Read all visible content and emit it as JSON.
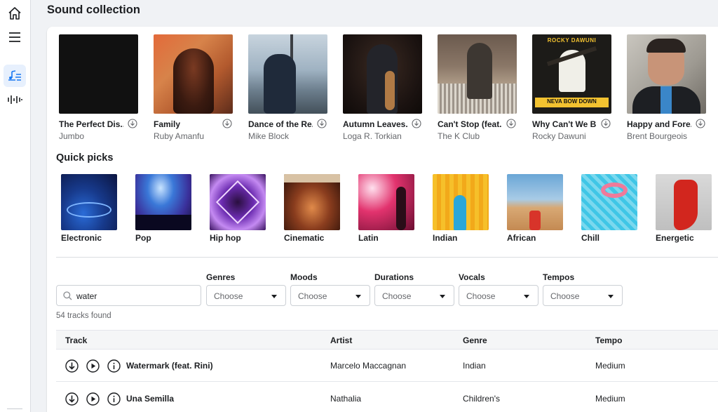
{
  "page_title": "Sound collection",
  "albums": [
    {
      "title": "The Perfect Dis...",
      "artist": "Jumbo"
    },
    {
      "title": "Family",
      "artist": "Ruby Amanfu"
    },
    {
      "title": "Dance of the Re...",
      "artist": "Mike Block"
    },
    {
      "title": "Autumn Leaves...",
      "artist": "Loga R. Torkian"
    },
    {
      "title": "Can't Stop (feat...",
      "artist": "The K Club"
    },
    {
      "title": "Why Can't We B...",
      "artist": "Rocky Dawuni"
    },
    {
      "title": "Happy and Fore...",
      "artist": "Brent Bourgeois"
    }
  ],
  "cover_art": {
    "rocky_top": "ROCKY DAWUNI",
    "rocky_bottom": "NEVA BOW DOWN"
  },
  "quick_picks": {
    "title": "Quick picks",
    "items": [
      "Electronic",
      "Pop",
      "Hip hop",
      "Cinematic",
      "Latin",
      "Indian",
      "African",
      "Chill",
      "Energetic"
    ]
  },
  "search": {
    "value": "water"
  },
  "filters": [
    {
      "label": "Genres",
      "value": "Choose"
    },
    {
      "label": "Moods",
      "value": "Choose"
    },
    {
      "label": "Durations",
      "value": "Choose"
    },
    {
      "label": "Vocals",
      "value": "Choose"
    },
    {
      "label": "Tempos",
      "value": "Choose"
    }
  ],
  "tracks_found": "54 tracks found",
  "table": {
    "headers": {
      "track": "Track",
      "artist": "Artist",
      "genre": "Genre",
      "tempo": "Tempo"
    },
    "rows": [
      {
        "track": "Watermark (feat. Rini)",
        "artist": "Marcelo Maccagnan",
        "genre": "Indian",
        "tempo": "Medium"
      },
      {
        "track": "Una Semilla",
        "artist": "Nathalia",
        "genre": "Children's",
        "tempo": "Medium"
      }
    ]
  },
  "colors": {
    "accent": "#1877f2",
    "background": "#f0f2f5",
    "text": "#1c1e21",
    "muted": "#65676b"
  }
}
